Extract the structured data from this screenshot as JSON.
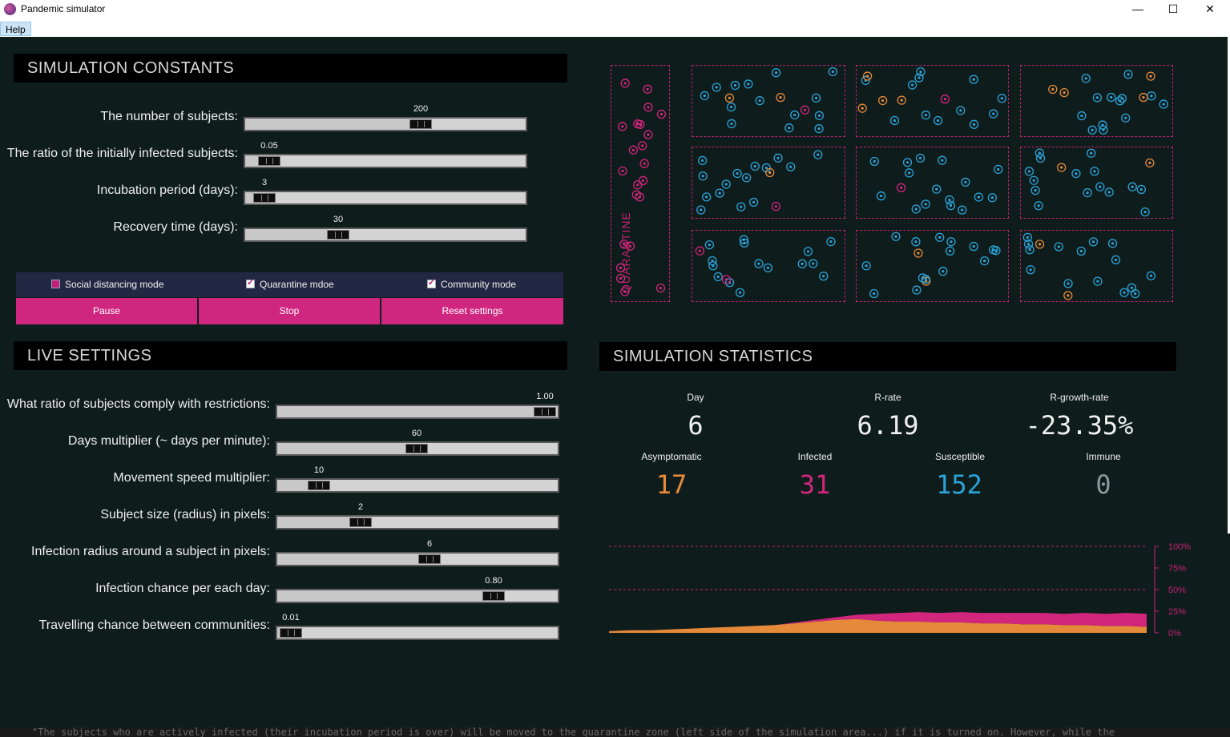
{
  "window": {
    "title": "Pandemic simulator",
    "minimize": "—",
    "maximize": "☐",
    "close": "✕"
  },
  "menu": {
    "help": "Help"
  },
  "constants": {
    "header": "SIMULATION CONSTANTS",
    "rows": [
      {
        "label": "The number of subjects:",
        "value": "200",
        "fraction": 0.64
      },
      {
        "label": "The ratio of the initially infected subjects:",
        "value": "0.05",
        "fraction": 0.05
      },
      {
        "label": "Incubation period (days):",
        "value": "3",
        "fraction": 0.03
      },
      {
        "label": "Recovery time (days):",
        "value": "30",
        "fraction": 0.32
      }
    ]
  },
  "modes": {
    "social_distancing": {
      "label": "Social distancing mode",
      "checked": false
    },
    "quarantine": {
      "label": "Quarantine mdoe",
      "checked": true
    },
    "community": {
      "label": "Community mode",
      "checked": true
    }
  },
  "actions": {
    "pause": "Pause",
    "stop": "Stop",
    "reset": "Reset settings"
  },
  "live": {
    "header": "LIVE SETTINGS",
    "rows": [
      {
        "label": "What ratio of subjects comply with restrictions:",
        "value": "1.00",
        "fraction": 1.0
      },
      {
        "label": "Days multiplier (~ days per minute):",
        "value": "60",
        "fraction": 0.5
      },
      {
        "label": "Movement speed multiplier:",
        "value": "10",
        "fraction": 0.12
      },
      {
        "label": "Subject size (radius) in pixels:",
        "value": "2",
        "fraction": 0.28
      },
      {
        "label": "Infection radius around a subject in pixels:",
        "value": "6",
        "fraction": 0.55
      },
      {
        "label": "Infection chance per each day:",
        "value": "0.80",
        "fraction": 0.8
      },
      {
        "label": "Travelling chance between communities:",
        "value": "0.01",
        "fraction": 0.01
      }
    ]
  },
  "simulation": {
    "quarantine_label": "QUARANTINE"
  },
  "statistics": {
    "header": "SIMULATION STATISTICS",
    "day": {
      "label": "Day",
      "value": "6"
    },
    "r_rate": {
      "label": "R-rate",
      "value": "6.19"
    },
    "r_growth_rate": {
      "label": "R-growth-rate",
      "value": "-23.35%"
    },
    "asymptomatic": {
      "label": "Asymptomatic",
      "value": "17"
    },
    "infected": {
      "label": "Infected",
      "value": "31"
    },
    "susceptible": {
      "label": "Susceptible",
      "value": "152"
    },
    "immune": {
      "label": "Immune",
      "value": "0"
    }
  },
  "colors": {
    "susceptible": "#2aa3d8",
    "infected": "#d1267c",
    "asymptomatic": "#e5893a",
    "immune": "#8a9a9a",
    "accent": "#cf2780"
  },
  "chart_data": {
    "type": "area",
    "y_ticks": [
      "100%",
      "75%",
      "50%",
      "25%",
      "0%"
    ],
    "ylim": [
      0,
      100
    ],
    "grid": "dashed lines at 50% and 100%",
    "series": [
      {
        "color": "#e5893a",
        "values": [
          2,
          3,
          3,
          4,
          5,
          6,
          7,
          8,
          9,
          11,
          13,
          15,
          16,
          14,
          13,
          13,
          12,
          12,
          11,
          11,
          10,
          10,
          9,
          9,
          8,
          8,
          7
        ]
      },
      {
        "color": "#d1267c",
        "values": [
          0,
          0,
          0,
          0,
          0,
          0,
          0,
          0,
          0,
          1,
          2,
          3,
          5,
          8,
          10,
          11,
          11,
          12,
          12,
          12,
          13,
          13,
          13,
          14,
          14,
          15,
          15
        ]
      }
    ]
  },
  "bottom_text": "\"The subjects who are actively infected (their incubation period is over) will be moved to the quarantine zone (left side of the simulation area...) if it is turned on. However, while the"
}
